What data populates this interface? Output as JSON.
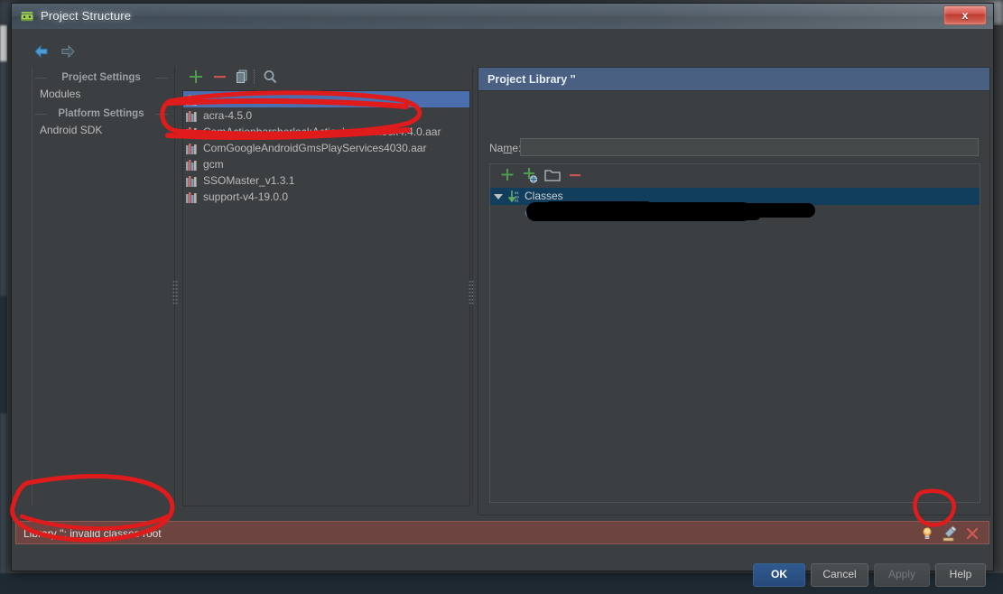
{
  "window": {
    "title": "Project Structure",
    "icon": "android-icon",
    "close_label": "x"
  },
  "nav": {
    "back_icon": "arrow-left-icon",
    "forward_icon": "arrow-right-icon"
  },
  "sidebar": {
    "groups": [
      {
        "title": "Project Settings",
        "items": [
          {
            "label": "Modules"
          }
        ]
      },
      {
        "title": "Platform Settings",
        "items": [
          {
            "label": "Android SDK"
          }
        ]
      }
    ]
  },
  "libs_toolbar": {
    "add": {
      "label": "+",
      "icon": "plus-icon"
    },
    "remove": {
      "label": "−",
      "icon": "minus-icon"
    },
    "copy": {
      "label": "",
      "icon": "copy-icon"
    },
    "search": {
      "label": "",
      "icon": "search-icon"
    }
  },
  "libraries": {
    "items": [
      {
        "label": "''",
        "selected": true,
        "icon": "library-icon"
      },
      {
        "label": "acra-4.5.0",
        "selected": false,
        "icon": "library-icon"
      },
      {
        "label": "ComActionbarsherlockActionbarsherlock4.4.0.aar",
        "selected": false,
        "icon": "library-icon"
      },
      {
        "label": "ComGoogleAndroidGmsPlayServices4030.aar",
        "selected": false,
        "icon": "library-icon"
      },
      {
        "label": "gcm",
        "selected": false,
        "icon": "library-icon"
      },
      {
        "label": "SSOMaster_v1.3.1",
        "selected": false,
        "icon": "library-icon"
      },
      {
        "label": "support-v4-19.0.0",
        "selected": false,
        "icon": "library-icon"
      }
    ]
  },
  "detail": {
    "header": "Project Library ''",
    "name_label_pre": "Na",
    "name_label_mnemonic": "m",
    "name_label_post": "e:",
    "name_value": "",
    "name_placeholder": "",
    "roots_toolbar": {
      "add": {
        "icon": "plus-icon"
      },
      "add_url": {
        "icon": "plus-globe-icon"
      },
      "folder": {
        "icon": "folder-icon"
      },
      "remove": {
        "icon": "minus-icon"
      }
    },
    "tree": {
      "classes_node": {
        "label": "Classes",
        "icon": "classes-icon",
        "expanded": true,
        "selected": true
      },
      "child_node": {
        "label": "",
        "icon": "unknown-file-icon",
        "redacted": true
      }
    }
  },
  "error": {
    "message": "Library '': invalid classes root",
    "hint_icon": "lightbulb-icon",
    "fix_icon": "quickfix-icon",
    "close_icon": "close-x-icon"
  },
  "buttons": {
    "ok": "OK",
    "cancel": "Cancel",
    "apply": "Apply",
    "help": "Help"
  },
  "colors": {
    "accent_selection": "#4b6eaf",
    "panel_header": "#4a6082",
    "error_bg": "#6e4441",
    "annotation_red": "#e01b1b",
    "dialog_bg": "#3c3f41"
  }
}
